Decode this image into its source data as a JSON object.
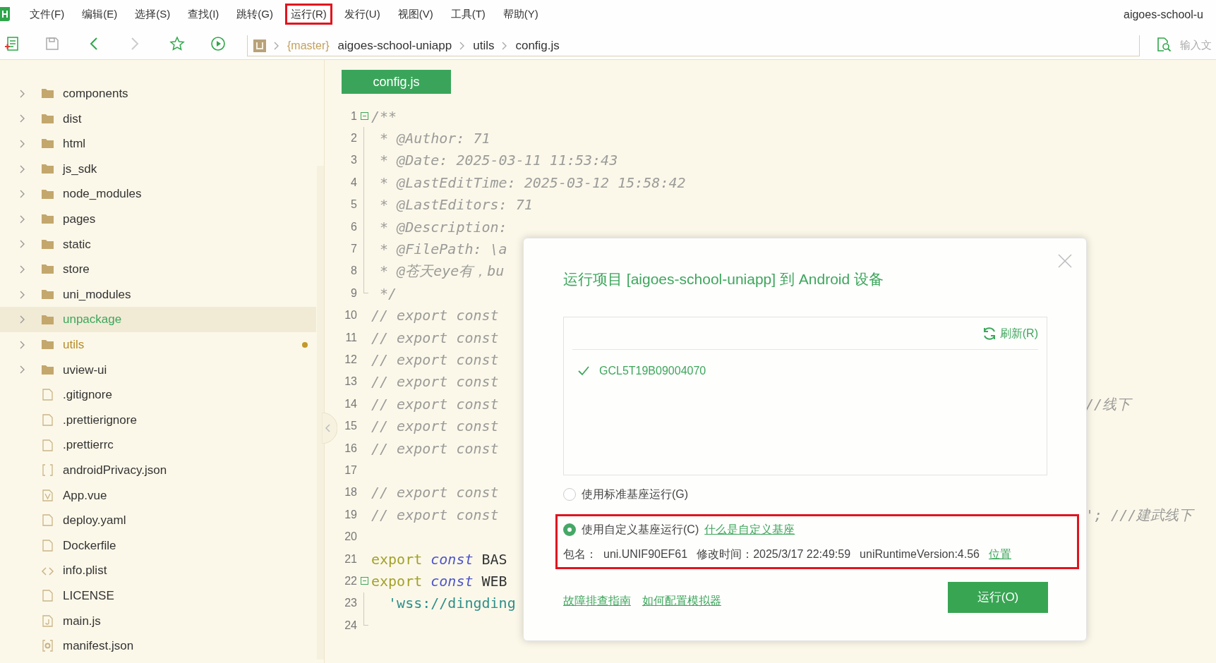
{
  "menu": [
    {
      "label": "文件(F)",
      "highlighted": false
    },
    {
      "label": "编辑(E)",
      "highlighted": false
    },
    {
      "label": "选择(S)",
      "highlighted": false
    },
    {
      "label": "查找(I)",
      "highlighted": false
    },
    {
      "label": "跳转(G)",
      "highlighted": false
    },
    {
      "label": "运行(R)",
      "highlighted": true
    },
    {
      "label": "发行(U)",
      "highlighted": false
    },
    {
      "label": "视图(V)",
      "highlighted": false
    },
    {
      "label": "工具(T)",
      "highlighted": false
    },
    {
      "label": "帮助(Y)",
      "highlighted": false
    }
  ],
  "window_title": "aigoes-school-u",
  "breadcrumb": {
    "branch": "{master}",
    "parts": [
      "aigoes-school-uniapp",
      "utils",
      "config.js"
    ]
  },
  "search": {
    "placeholder": "输入文"
  },
  "sidebar": {
    "items": [
      {
        "kind": "folder",
        "name": "components",
        "selected": false,
        "modified": false
      },
      {
        "kind": "folder",
        "name": "dist",
        "selected": false,
        "modified": false
      },
      {
        "kind": "folder",
        "name": "html",
        "selected": false,
        "modified": false
      },
      {
        "kind": "folder",
        "name": "js_sdk",
        "selected": false,
        "modified": false
      },
      {
        "kind": "folder",
        "name": "node_modules",
        "selected": false,
        "modified": false
      },
      {
        "kind": "folder",
        "name": "pages",
        "selected": false,
        "modified": false
      },
      {
        "kind": "folder",
        "name": "static",
        "selected": false,
        "modified": false
      },
      {
        "kind": "folder",
        "name": "store",
        "selected": false,
        "modified": false
      },
      {
        "kind": "folder",
        "name": "uni_modules",
        "selected": false,
        "modified": false
      },
      {
        "kind": "folder",
        "name": "unpackage",
        "selected": true,
        "modified": false
      },
      {
        "kind": "folder",
        "name": "utils",
        "selected": false,
        "modified": true
      },
      {
        "kind": "folder",
        "name": "uview-ui",
        "selected": false,
        "modified": false
      },
      {
        "kind": "file",
        "name": ".gitignore",
        "selected": false,
        "modified": false
      },
      {
        "kind": "file",
        "name": ".prettierignore",
        "selected": false,
        "modified": false
      },
      {
        "kind": "file",
        "name": ".prettierrc",
        "selected": false,
        "modified": false
      },
      {
        "kind": "json",
        "name": "androidPrivacy.json",
        "selected": false,
        "modified": false
      },
      {
        "kind": "vue",
        "name": "App.vue",
        "selected": false,
        "modified": false
      },
      {
        "kind": "file",
        "name": "deploy.yaml",
        "selected": false,
        "modified": false
      },
      {
        "kind": "file",
        "name": "Dockerfile",
        "selected": false,
        "modified": false
      },
      {
        "kind": "markup",
        "name": "info.plist",
        "selected": false,
        "modified": false
      },
      {
        "kind": "file",
        "name": "LICENSE",
        "selected": false,
        "modified": false
      },
      {
        "kind": "js",
        "name": "main.js",
        "selected": false,
        "modified": false
      },
      {
        "kind": "manifest",
        "name": "manifest.json",
        "selected": false,
        "modified": false
      }
    ]
  },
  "editor": {
    "tab": "config.js",
    "lines": [
      {
        "number": "1",
        "fold_start": true,
        "segments": [
          {
            "kind": "comment",
            "text": "/**"
          }
        ]
      },
      {
        "number": "2",
        "fold_guide": true,
        "segments": [
          {
            "kind": "comment",
            "text": " * @Author: 71"
          }
        ]
      },
      {
        "number": "3",
        "fold_guide": true,
        "segments": [
          {
            "kind": "comment",
            "text": " * @Date: 2025-03-11 11:53:43"
          }
        ]
      },
      {
        "number": "4",
        "fold_guide": true,
        "segments": [
          {
            "kind": "comment",
            "text": " * @LastEditTime: 2025-03-12 15:58:42"
          }
        ]
      },
      {
        "number": "5",
        "fold_guide": true,
        "segments": [
          {
            "kind": "comment",
            "text": " * @LastEditors: 71"
          }
        ]
      },
      {
        "number": "6",
        "fold_guide": true,
        "segments": [
          {
            "kind": "comment",
            "text": " * @Description:"
          }
        ]
      },
      {
        "number": "7",
        "fold_guide": true,
        "segments": [
          {
            "kind": "comment",
            "text": " * @FilePath: \\a"
          }
        ]
      },
      {
        "number": "8",
        "fold_guide": true,
        "segments": [
          {
            "kind": "comment",
            "text": " * @苍天eye有，bu"
          }
        ]
      },
      {
        "number": "9",
        "fold_end": true,
        "segments": [
          {
            "kind": "comment",
            "text": " */"
          }
        ]
      },
      {
        "number": "10",
        "segments": [
          {
            "kind": "comment",
            "text": "// export const"
          }
        ]
      },
      {
        "number": "11",
        "segments": [
          {
            "kind": "comment",
            "text": "// export const"
          }
        ]
      },
      {
        "number": "12",
        "segments": [
          {
            "kind": "comment",
            "text": "// export const"
          }
        ]
      },
      {
        "number": "13",
        "segments": [
          {
            "kind": "comment",
            "text": "// export const"
          }
        ]
      },
      {
        "number": "14",
        "segments": [
          {
            "kind": "comment",
            "text": "// export const"
          }
        ],
        "tail": "//线下"
      },
      {
        "number": "15",
        "segments": [
          {
            "kind": "comment",
            "text": "// export const"
          }
        ]
      },
      {
        "number": "16",
        "segments": [
          {
            "kind": "comment",
            "text": "// export const"
          }
        ]
      },
      {
        "number": "17"
      },
      {
        "number": "18",
        "segments": [
          {
            "kind": "comment",
            "text": "// export const"
          }
        ]
      },
      {
        "number": "19",
        "segments": [
          {
            "kind": "comment",
            "text": "// export const"
          }
        ],
        "tail": "'; ///建武线下"
      },
      {
        "number": "20"
      },
      {
        "number": "21",
        "segments": [
          {
            "kind": "keyword",
            "text": "export"
          },
          {
            "kind": "storage",
            "text": " const"
          },
          {
            "kind": "plain",
            "text": " BAS"
          }
        ]
      },
      {
        "number": "22",
        "fold_start": true,
        "segments": [
          {
            "kind": "keyword",
            "text": "export"
          },
          {
            "kind": "storage",
            "text": " const"
          },
          {
            "kind": "plain",
            "text": " WEB"
          }
        ]
      },
      {
        "number": "23",
        "fold_guide": true,
        "segments": [
          {
            "kind": "string",
            "text": "  'wss://dingding"
          }
        ]
      },
      {
        "number": "24",
        "fold_end": true
      }
    ]
  },
  "dialog": {
    "title": "运行项目 [aigoes-school-uniapp] 到 Android 设备",
    "refresh": "刷新(R)",
    "devices": [
      {
        "name": "GCL5T19B09004070",
        "checked": true
      }
    ],
    "options": [
      {
        "label": "使用标准基座运行(G)",
        "selected": false
      },
      {
        "label": "使用自定义基座运行(C)",
        "selected": true,
        "link": "什么是自定义基座",
        "highlighted": true,
        "details": [
          "包名：",
          "uni.UNIF90EF61",
          "修改时间：2025/3/17 22:49:59",
          "uniRuntimeVersion:4.56"
        ],
        "details_link": "位置"
      }
    ],
    "footer_links": [
      "故障排查指南",
      "如何配置模拟器"
    ],
    "run_button": "运行(O)"
  }
}
